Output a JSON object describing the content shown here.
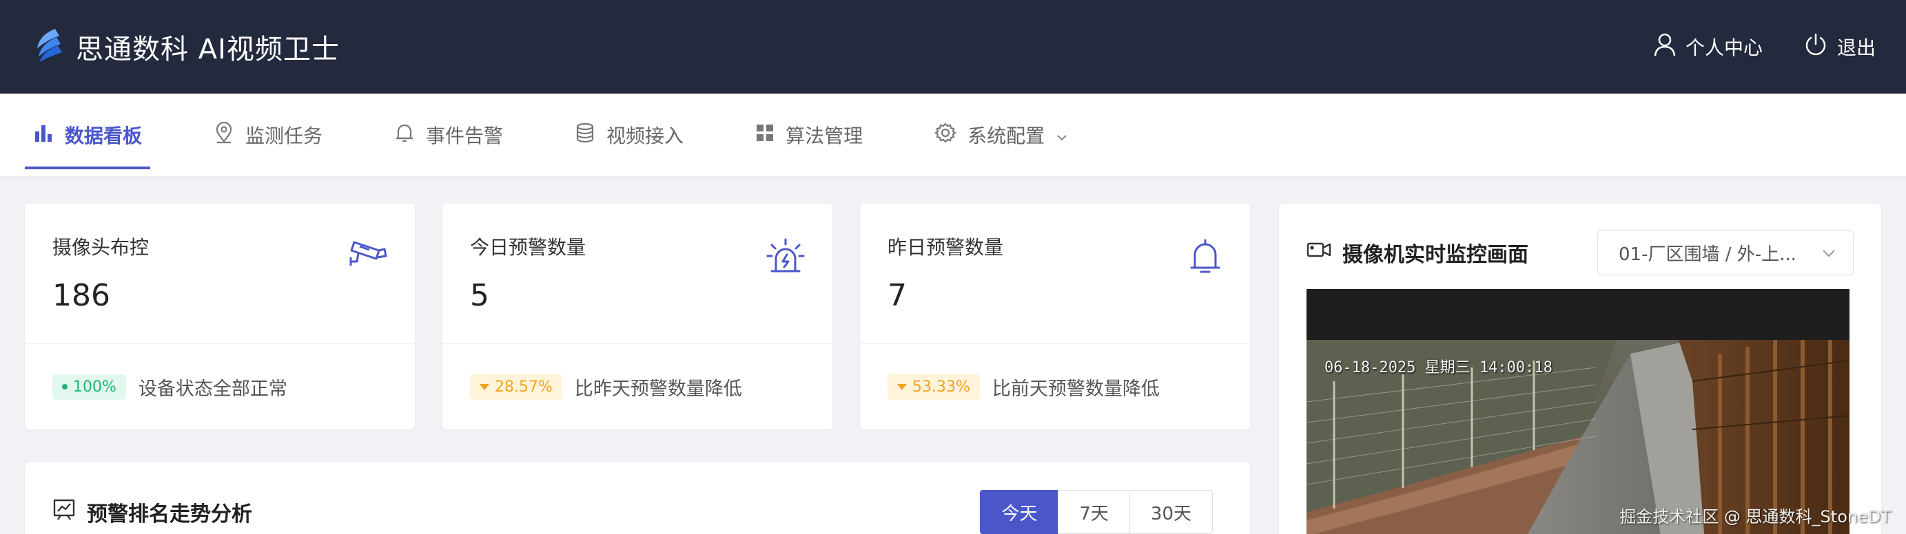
{
  "app": {
    "title": "思通数科 AI视频卫士"
  },
  "topbar": {
    "user_center": "个人中心",
    "logout": "退出"
  },
  "nav": {
    "items": [
      {
        "label": "数据看板",
        "icon": "bar-chart-icon",
        "active": true
      },
      {
        "label": "监测任务",
        "icon": "location-pin-icon"
      },
      {
        "label": "事件告警",
        "icon": "bell-icon"
      },
      {
        "label": "视频接入",
        "icon": "database-icon"
      },
      {
        "label": "算法管理",
        "icon": "grid-icon"
      },
      {
        "label": "系统配置",
        "icon": "gear-icon"
      }
    ]
  },
  "stats": [
    {
      "label": "摄像头布控",
      "value": "186",
      "badge": "100%",
      "badge_type": "up",
      "note": "设备状态全部正常",
      "icon": "cctv-camera-icon"
    },
    {
      "label": "今日预警数量",
      "value": "5",
      "badge": "28.57%",
      "badge_type": "down",
      "note": "比昨天预警数量降低",
      "icon": "alarm-siren-icon"
    },
    {
      "label": "昨日预警数量",
      "value": "7",
      "badge": "53.33%",
      "badge_type": "down",
      "note": "比前天预警数量降低",
      "icon": "bell-icon"
    }
  ],
  "monitor": {
    "title": "摄像机实时监控画面",
    "selected_camera": "01-厂区围墙 / 外-上...",
    "osd_timestamp": "06-18-2025 星期三 14:00:18",
    "watermark": "掘金技术社区 @ 思通数科_StoneDT"
  },
  "trend": {
    "title": "预警排名走势分析",
    "ranges": [
      "今天",
      "7天",
      "30天"
    ],
    "active_range": "今天"
  },
  "colors": {
    "topbar_bg": "#232a3d",
    "accent": "#4b57c9",
    "success": "#1fb47a",
    "warning": "#f0a41e"
  }
}
